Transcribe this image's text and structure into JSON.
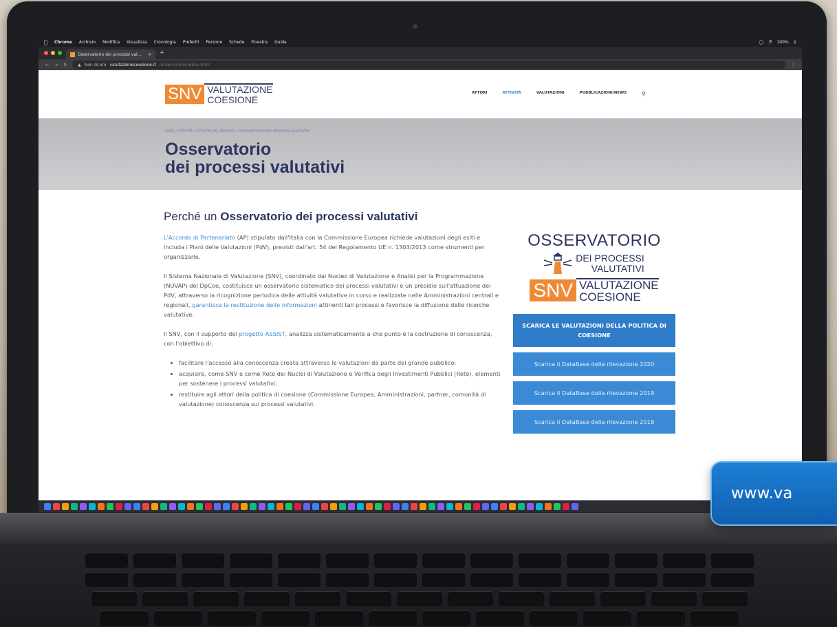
{
  "menubar": {
    "app": "Chrome",
    "items": [
      "Archivio",
      "Modifica",
      "Visualizza",
      "Cronologia",
      "Preferiti",
      "Persone",
      "Schede",
      "Finestra",
      "Guida"
    ],
    "battery": "100%"
  },
  "browser": {
    "tab_title": "Osservatorio dei processi val...",
    "security": "Non sicuro",
    "url_host": "valutazionecoesione.it",
    "url_path": "/osservatorio/index.html"
  },
  "site": {
    "logo_mark": "SNV",
    "logo_line1": "VALUTAZIONE",
    "logo_line2": "COESIONE",
    "nav": [
      "ATTORI",
      "ATTIVITÀ",
      "VALUTAZIONI",
      "PUBBLICAZIONI/NEWS"
    ],
    "breadcrumb": "SNVR / ATTIVITÀ / ATTIVITÀ DEL SISTEMA / OSSERVATORIO DEI PROCESSI VALUTATIVI",
    "hero_title_1": "Osservatorio",
    "hero_title_2": "dei processi valutativi"
  },
  "content": {
    "heading_pre": "Perché un ",
    "heading_bold": "Osservatorio dei processi valutativi",
    "p1_link": "L'Accordo di Partenariato",
    "p1_text": " (AP) stipulato dall'Italia con la Commissione Europea richiede valutazioni degli esiti e includa i Piani delle Valutazioni (PdV), previsti dall'art. 54 del Regolamento UE n. 1303/2013 come strumenti per organizzarle.",
    "p2_text": "Il Sistema Nazionale di Valutazione (SNV), coordinato dal Nucleo di Valutazione e Analisi per la Programmazione (NUVAP) del DpCoe, costituisce un osservatorio sistematico dei processi valutativi e un presidio sull'attuazione dei PdV, attraverso la ricognizione periodica delle attività valutative in corso e realizzate nelle Amministrazioni centrali e regionali, ",
    "p2_link": "garantisce la restituzione delle informazioni",
    "p2_tail": " attinenti tali processi e favorisce la diffusione delle ricerche valutative.",
    "p3_pre": "Il SNV, con il supporto del ",
    "p3_link": "progetto ASSIST",
    "p3_tail": ", analizza sistematicamente a che punto è la costruzione di conoscenza, con l'obiettivo di:",
    "bullets": [
      "facilitare l'accesso alla conoscenza creata attraverso le valutazioni da parte del grande pubblico;",
      "acquisire, come SNV e come Rete dei Nuclei di Valutazione e Verifica degli Investimenti Pubblici (Rete), elementi per sostenere i processi valutativi;",
      "restituire agli attori della politica di coesione (Commissione Europea, Amministrazioni, partner, comunità di valutazione) conoscenza sui processi valutativi."
    ]
  },
  "sidebar": {
    "obs_title": "OSSERVATORIO",
    "obs_sub1": "DEI PROCESSI",
    "obs_sub2": "VALUTATIVI",
    "brand_mark": "SNV",
    "brand_line1": "VALUTAZIONE",
    "brand_line2": "COESIONE",
    "buttons": [
      "SCARICA LE VALUTAZIONI DELLA POLITICA DI COESIONE",
      "Scarica il DataBase della rilevazione 2020",
      "Scarica il DataBase della rilevazione 2019",
      "Scarica il DataBase della rilevazione 2018"
    ]
  },
  "overlay": {
    "text": "www.va"
  },
  "colors": {
    "accent_orange": "#ef8a34",
    "navy": "#2d3560",
    "link_blue": "#3a8ad6",
    "overlay_blue": "#1f7fd4"
  }
}
